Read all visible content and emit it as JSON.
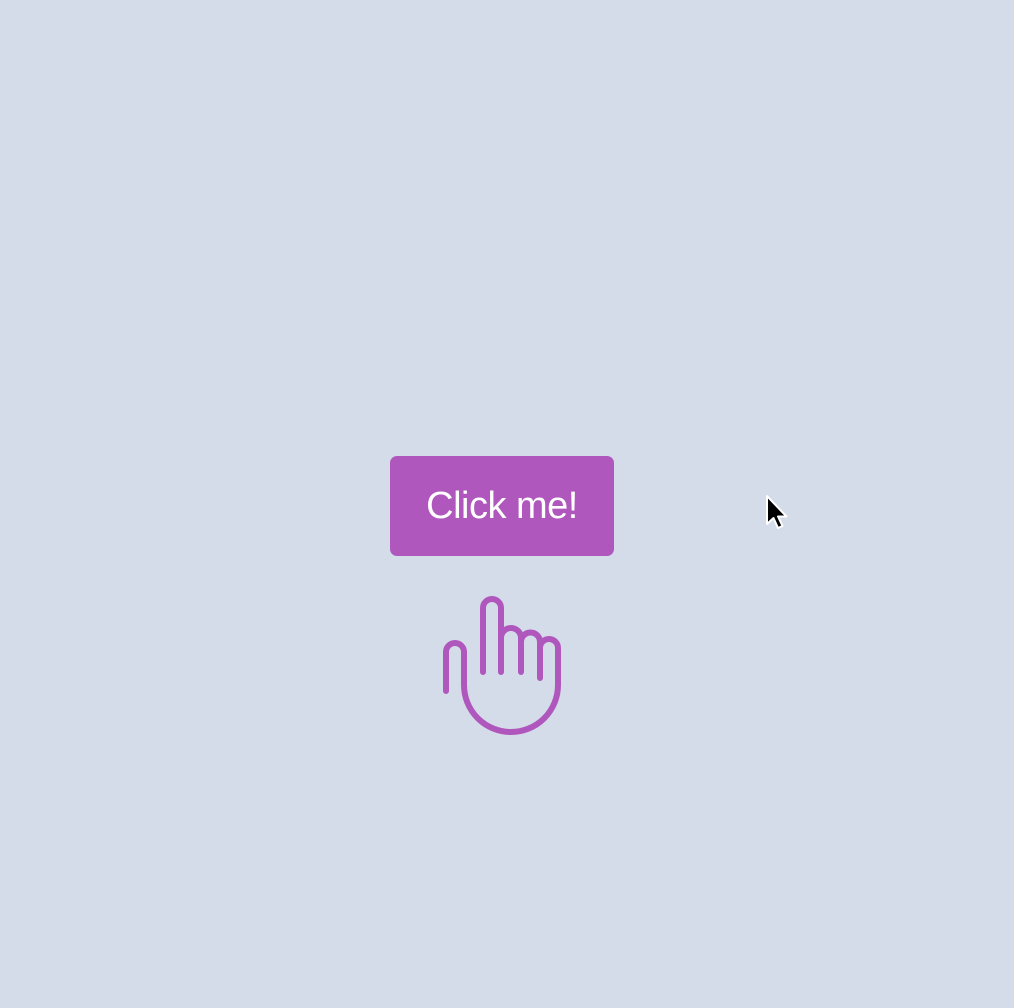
{
  "button": {
    "label": "Click me!"
  },
  "colors": {
    "background": "#d5dce9",
    "accent": "#b057be",
    "button_text": "#ffffff"
  },
  "icons": {
    "hand": "pointing-hand-icon",
    "cursor": "mouse-cursor-icon"
  }
}
